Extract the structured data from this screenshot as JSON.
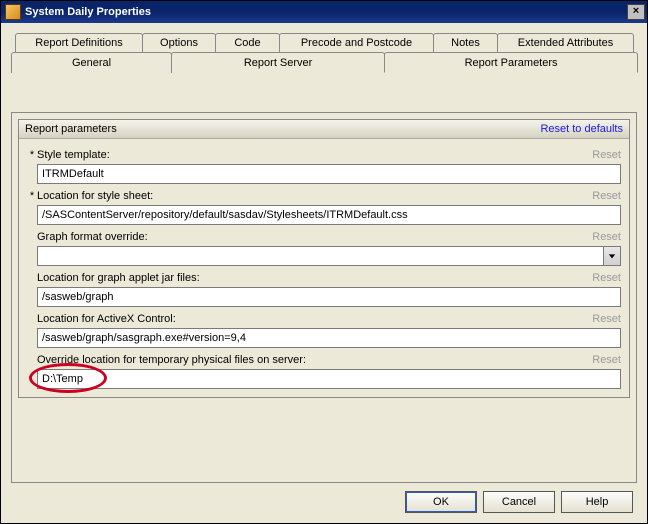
{
  "window": {
    "title": "System Daily Properties"
  },
  "tabs": {
    "row1": [
      {
        "label": "Report Definitions"
      },
      {
        "label": "Options"
      },
      {
        "label": "Code"
      },
      {
        "label": "Precode and Postcode"
      },
      {
        "label": "Notes"
      },
      {
        "label": "Extended Attributes"
      }
    ],
    "row2": [
      {
        "label": "General"
      },
      {
        "label": "Report Server"
      },
      {
        "label": "Report Parameters"
      }
    ]
  },
  "group": {
    "title": "Report parameters",
    "reset_defaults": "Reset to defaults"
  },
  "params": [
    {
      "required": "*",
      "label": "Style template:",
      "reset": "Reset",
      "value": "ITRMDefault",
      "type": "text"
    },
    {
      "required": "*",
      "label": "Location for style sheet:",
      "reset": "Reset",
      "value": "/SASContentServer/repository/default/sasdav/Stylesheets/ITRMDefault.css",
      "type": "text"
    },
    {
      "required": "",
      "label": "Graph format override:",
      "reset": "Reset",
      "value": "",
      "type": "combo"
    },
    {
      "required": "",
      "label": "Location for graph applet jar files:",
      "reset": "Reset",
      "value": "/sasweb/graph",
      "type": "text"
    },
    {
      "required": "",
      "label": "Location for ActiveX Control:",
      "reset": "Reset",
      "value": "/sasweb/graph/sasgraph.exe#version=9,4",
      "type": "text"
    },
    {
      "required": "",
      "label": "Override location for temporary physical files on server:",
      "reset": "Reset",
      "value": "D:\\Temp",
      "type": "text"
    }
  ],
  "buttons": {
    "ok": "OK",
    "cancel": "Cancel",
    "help": "Help"
  }
}
